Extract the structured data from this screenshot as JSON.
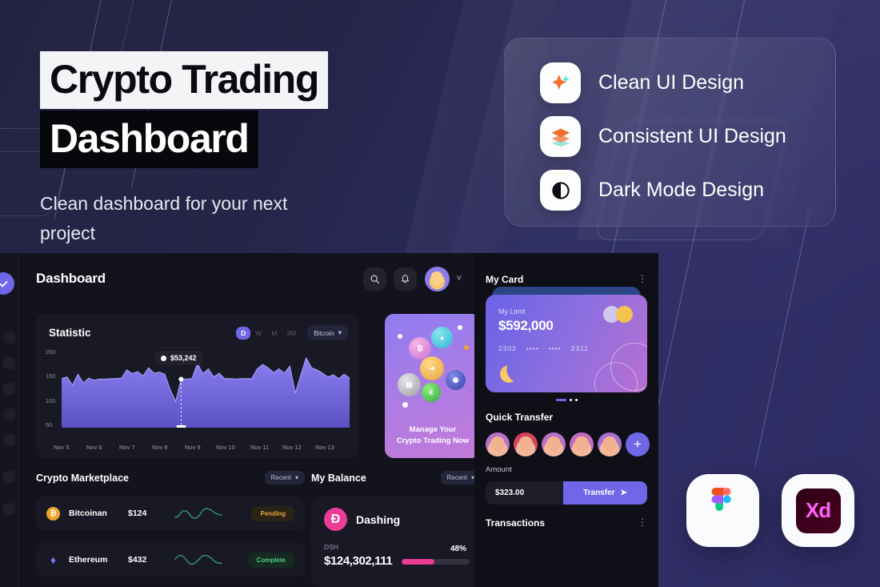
{
  "hero": {
    "title_line1": "Crypto Trading",
    "title_line2": "Dashboard",
    "subtitle": "Clean dashboard for your next project"
  },
  "features": {
    "items": [
      {
        "label": "Clean UI Design",
        "icon": "sparkle-icon"
      },
      {
        "label": "Consistent UI Design",
        "icon": "layers-icon"
      },
      {
        "label": "Dark Mode Design",
        "icon": "contrast-icon"
      }
    ]
  },
  "dashboard": {
    "topbar": {
      "title": "Dashboard",
      "search_icon": "search-icon",
      "bell_icon": "bell-icon",
      "avatar": "avatar",
      "chevron": "˅"
    },
    "statistic": {
      "title": "Statistic",
      "ranges": [
        "D",
        "W",
        "M",
        "3M"
      ],
      "active_range": "D",
      "asset_dropdown": "Bitcoin",
      "tooltip_value": "$53,242"
    },
    "promo": {
      "line1": "Manage Your",
      "line2": "Crypto Trading Now"
    },
    "marketplace": {
      "title": "Crypto Marketplace",
      "filter": "Recent",
      "rows": [
        {
          "name": "Bitcoinan",
          "price": "$124",
          "status": "Pending",
          "symbol": "₿",
          "color": "#f0a52a",
          "status_color": "#e5a23b"
        },
        {
          "name": "Ethereum",
          "price": "$432",
          "status": "Complete",
          "symbol": "♦",
          "color": "#7b74ea",
          "status_color": "#4fc98d"
        }
      ]
    },
    "balance": {
      "title": "My Balance",
      "filter": "Recent",
      "coin_name": "Dashing",
      "coin_symbol": "Đ",
      "ticker": "DSH",
      "amount": "$124,302,111",
      "percent": "48%",
      "percent_value": 48
    },
    "card": {
      "title": "My Card",
      "limit_label": "My Limit",
      "limit_value": "$592,000",
      "number_first": "2302",
      "number_mask_a": "••••",
      "number_mask_b": "••••",
      "number_last": "2311"
    },
    "quick_transfer": {
      "title": "Quick Transfer",
      "add_label": "+",
      "amount_label": "Amount",
      "amount_value": "$323.00",
      "transfer_label": "Transfer"
    },
    "transactions": {
      "title": "Transactions"
    }
  },
  "tools": [
    {
      "name": "figma-logo",
      "label": "Figma"
    },
    {
      "name": "adobe-xd-logo",
      "label": "Xd"
    }
  ],
  "chart_data": {
    "type": "area",
    "title": "Statistic",
    "xlabel": "",
    "ylabel": "",
    "ylim": [
      50,
      200
    ],
    "yticks": [
      200,
      150,
      100,
      50
    ],
    "categories": [
      "Nov 5",
      "Nov 6",
      "Nov 7",
      "Nov 8",
      "Nov 9",
      "Nov 10",
      "Nov 11",
      "Nov 12",
      "Nov 13"
    ],
    "grid": true,
    "legend": false,
    "highlight": {
      "x": "Nov 8",
      "label": "$53,242",
      "value": 139
    },
    "series": [
      {
        "name": "Bitcoin",
        "values": [
          140,
          143,
          128,
          148,
          132,
          141,
          137,
          139,
          139,
          140,
          140,
          141,
          156,
          149,
          153,
          145,
          160,
          150,
          152,
          148,
          119,
          98,
          139,
          139,
          140,
          168,
          149,
          158,
          143,
          150,
          140,
          140,
          139,
          140,
          140,
          140,
          158,
          166,
          160,
          151,
          158,
          150,
          163,
          113,
          146,
          178,
          160,
          156,
          150,
          143,
          147,
          140,
          148,
          141
        ]
      }
    ]
  }
}
